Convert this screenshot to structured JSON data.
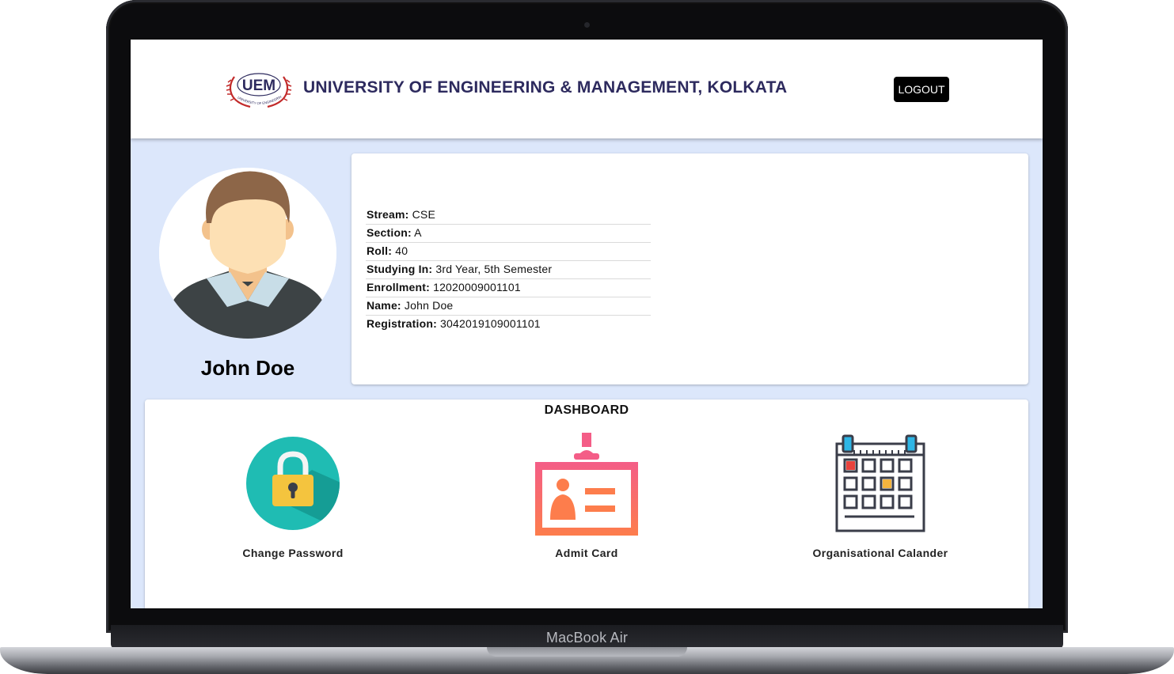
{
  "device": {
    "brand": "MacBook Air"
  },
  "header": {
    "logo_text": "UEM",
    "logo_ring_text": "UNIVERSITY OF ENGINEERING & MANAGEMENT",
    "title": "UNIVERSITY OF ENGINEERING & MANAGEMENT, KOLKATA",
    "logout_label": "LOGOUT"
  },
  "profile": {
    "name": "John Doe",
    "details": [
      {
        "label": "Stream:",
        "value": "CSE"
      },
      {
        "label": "Section:",
        "value": "A"
      },
      {
        "label": "Roll:",
        "value": "40"
      },
      {
        "label": "Studying In:",
        "value": "3rd Year, 5th Semester"
      },
      {
        "label": "Enrollment:",
        "value": "12020009001101"
      },
      {
        "label": "Name:",
        "value": "John Doe"
      },
      {
        "label": "Registration:",
        "value": "3042019109001101"
      }
    ]
  },
  "dashboard": {
    "title": "DASHBOARD",
    "tiles": [
      {
        "label": "Change Password",
        "icon": "lock-icon"
      },
      {
        "label": "Admit Card",
        "icon": "id-card-icon"
      },
      {
        "label": "Organisational Calander",
        "icon": "calendar-icon"
      }
    ]
  },
  "colors": {
    "header_title": "#2d2a5e",
    "page_background": "#dce7fb",
    "lock_circle": "#1fbcb3",
    "lock_body": "#f4c43e",
    "id_card_gradient_top": "#f45d87",
    "id_card_gradient_bottom": "#fd7d4c",
    "calendar_outline": "#3a3d49"
  }
}
